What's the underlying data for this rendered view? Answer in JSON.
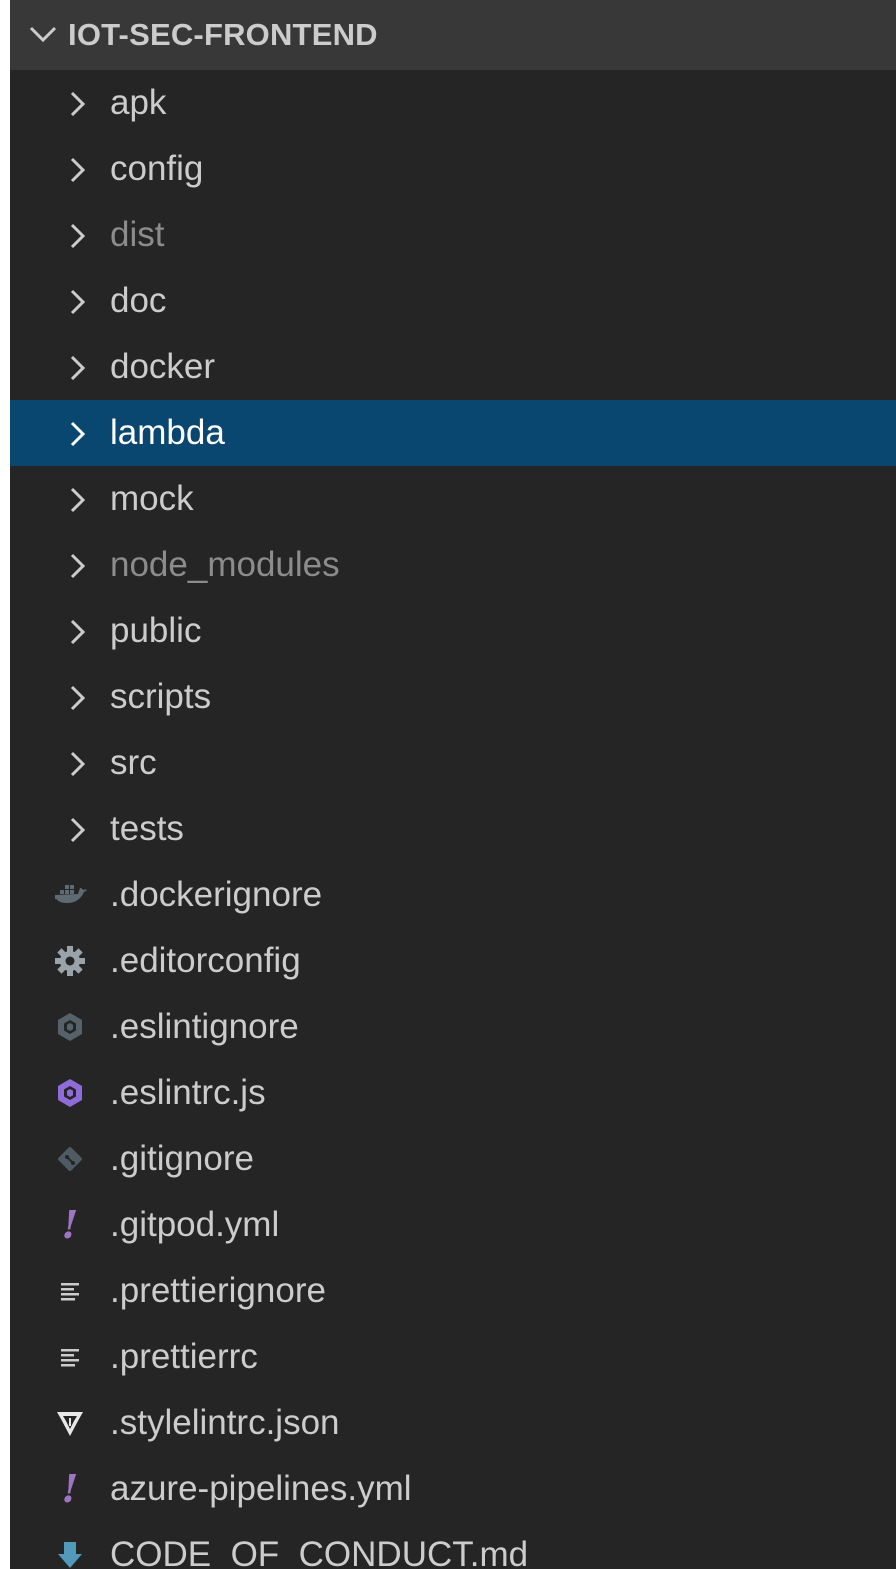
{
  "explorer": {
    "section_title": "IOT-SEC-FRONTEND",
    "folders": [
      {
        "label": "apk",
        "dim": false,
        "selected": false
      },
      {
        "label": "config",
        "dim": false,
        "selected": false
      },
      {
        "label": "dist",
        "dim": true,
        "selected": false
      },
      {
        "label": "doc",
        "dim": false,
        "selected": false
      },
      {
        "label": "docker",
        "dim": false,
        "selected": false
      },
      {
        "label": "lambda",
        "dim": false,
        "selected": true
      },
      {
        "label": "mock",
        "dim": false,
        "selected": false
      },
      {
        "label": "node_modules",
        "dim": true,
        "selected": false
      },
      {
        "label": "public",
        "dim": false,
        "selected": false
      },
      {
        "label": "scripts",
        "dim": false,
        "selected": false
      },
      {
        "label": "src",
        "dim": false,
        "selected": false
      },
      {
        "label": "tests",
        "dim": false,
        "selected": false
      }
    ],
    "files": [
      {
        "label": ".dockerignore",
        "icon": "docker-whale-icon"
      },
      {
        "label": ".editorconfig",
        "icon": "gear-icon"
      },
      {
        "label": ".eslintignore",
        "icon": "eslint-dim-icon"
      },
      {
        "label": ".eslintrc.js",
        "icon": "eslint-icon"
      },
      {
        "label": ".gitignore",
        "icon": "git-icon"
      },
      {
        "label": ".gitpod.yml",
        "icon": "yaml-exclamation-icon"
      },
      {
        "label": ".prettierignore",
        "icon": "text-lines-icon"
      },
      {
        "label": ".prettierrc",
        "icon": "text-lines-icon"
      },
      {
        "label": ".stylelintrc.json",
        "icon": "stylelint-icon"
      },
      {
        "label": "azure-pipelines.yml",
        "icon": "yaml-exclamation-icon"
      },
      {
        "label": "CODE_OF_CONDUCT.md",
        "icon": "markdown-download-icon"
      }
    ],
    "colors": {
      "background": "#252526",
      "header_background": "#383838",
      "selection": "#094771",
      "text": "#cccccc",
      "dim_text": "#8c8c8c",
      "eslint": "#8f6cd8",
      "yaml": "#a074c4",
      "markdown": "#519aba"
    }
  }
}
